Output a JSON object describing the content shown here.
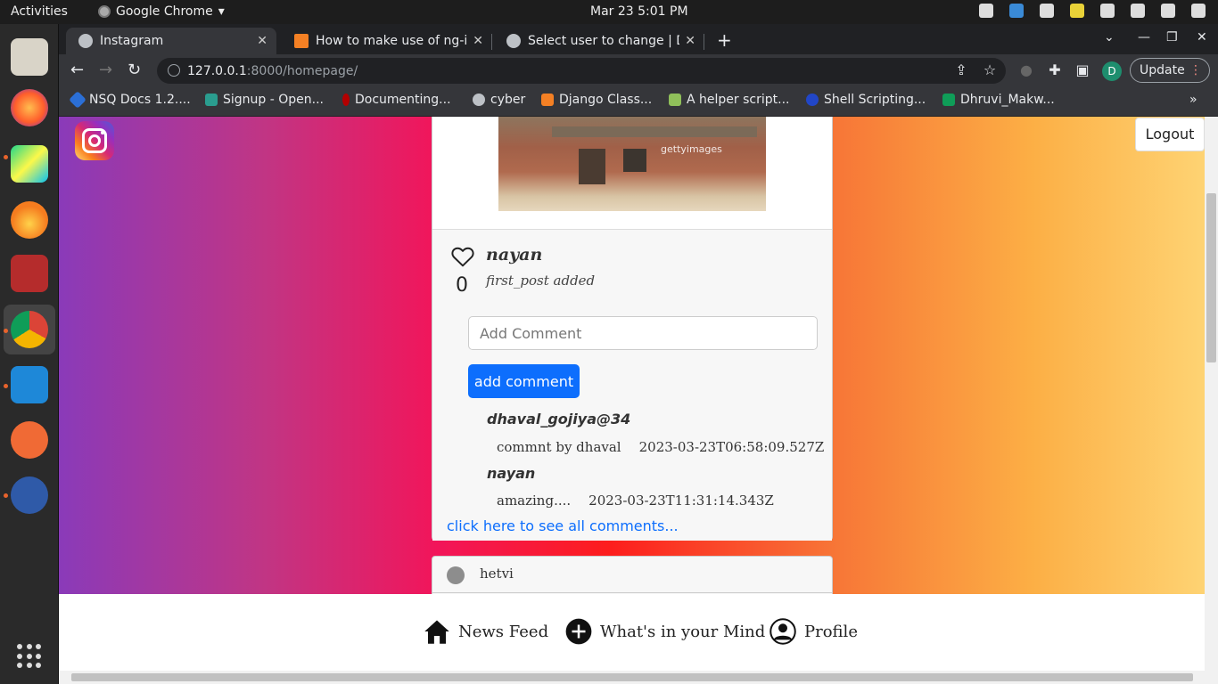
{
  "system": {
    "activities": "Activities",
    "app_name": "Google Chrome",
    "clock": "Mar 23  5:01 PM"
  },
  "browser": {
    "tabs": [
      {
        "title": "Instagram"
      },
      {
        "title": "How to make use of ng-if"
      },
      {
        "title": "Select user to change | Dja"
      }
    ],
    "url_host": "127.0.0.1",
    "url_path": ":8000/homepage/",
    "update_label": "Update",
    "profile_initial": "D",
    "bookmarks": [
      {
        "label": "NSQ Docs 1.2...."
      },
      {
        "label": "Signup - Open..."
      },
      {
        "label": "Documenting..."
      },
      {
        "label": "cyber"
      },
      {
        "label": "Django Class..."
      },
      {
        "label": "A helper script..."
      },
      {
        "label": "Shell Scripting..."
      },
      {
        "label": "Dhruvi_Makw..."
      }
    ]
  },
  "page": {
    "logout_label": "Logout",
    "post": {
      "image_watermark": "gettyimages",
      "like_count": "0",
      "username": "nayan",
      "caption": "first_post added",
      "comment_placeholder": "Add Comment",
      "add_comment_label": "add comment",
      "comments": [
        {
          "user": "dhaval_gojiya@34",
          "text": "commnt by dhaval",
          "timestamp": "2023-03-23T06:58:09.527Z"
        },
        {
          "user": "nayan",
          "text": "amazing....",
          "timestamp": "2023-03-23T11:31:14.343Z"
        }
      ],
      "see_all_label": "click here to see all comments..."
    },
    "next_post_user": "hetvi",
    "bottom_nav": {
      "news_feed": "News Feed",
      "whats_in_mind": "What's in your Mind",
      "profile": "Profile"
    }
  },
  "colors": {
    "primary_button": "#0d6efd",
    "chrome_frame": "#35363a",
    "tab_strip": "#202124"
  }
}
